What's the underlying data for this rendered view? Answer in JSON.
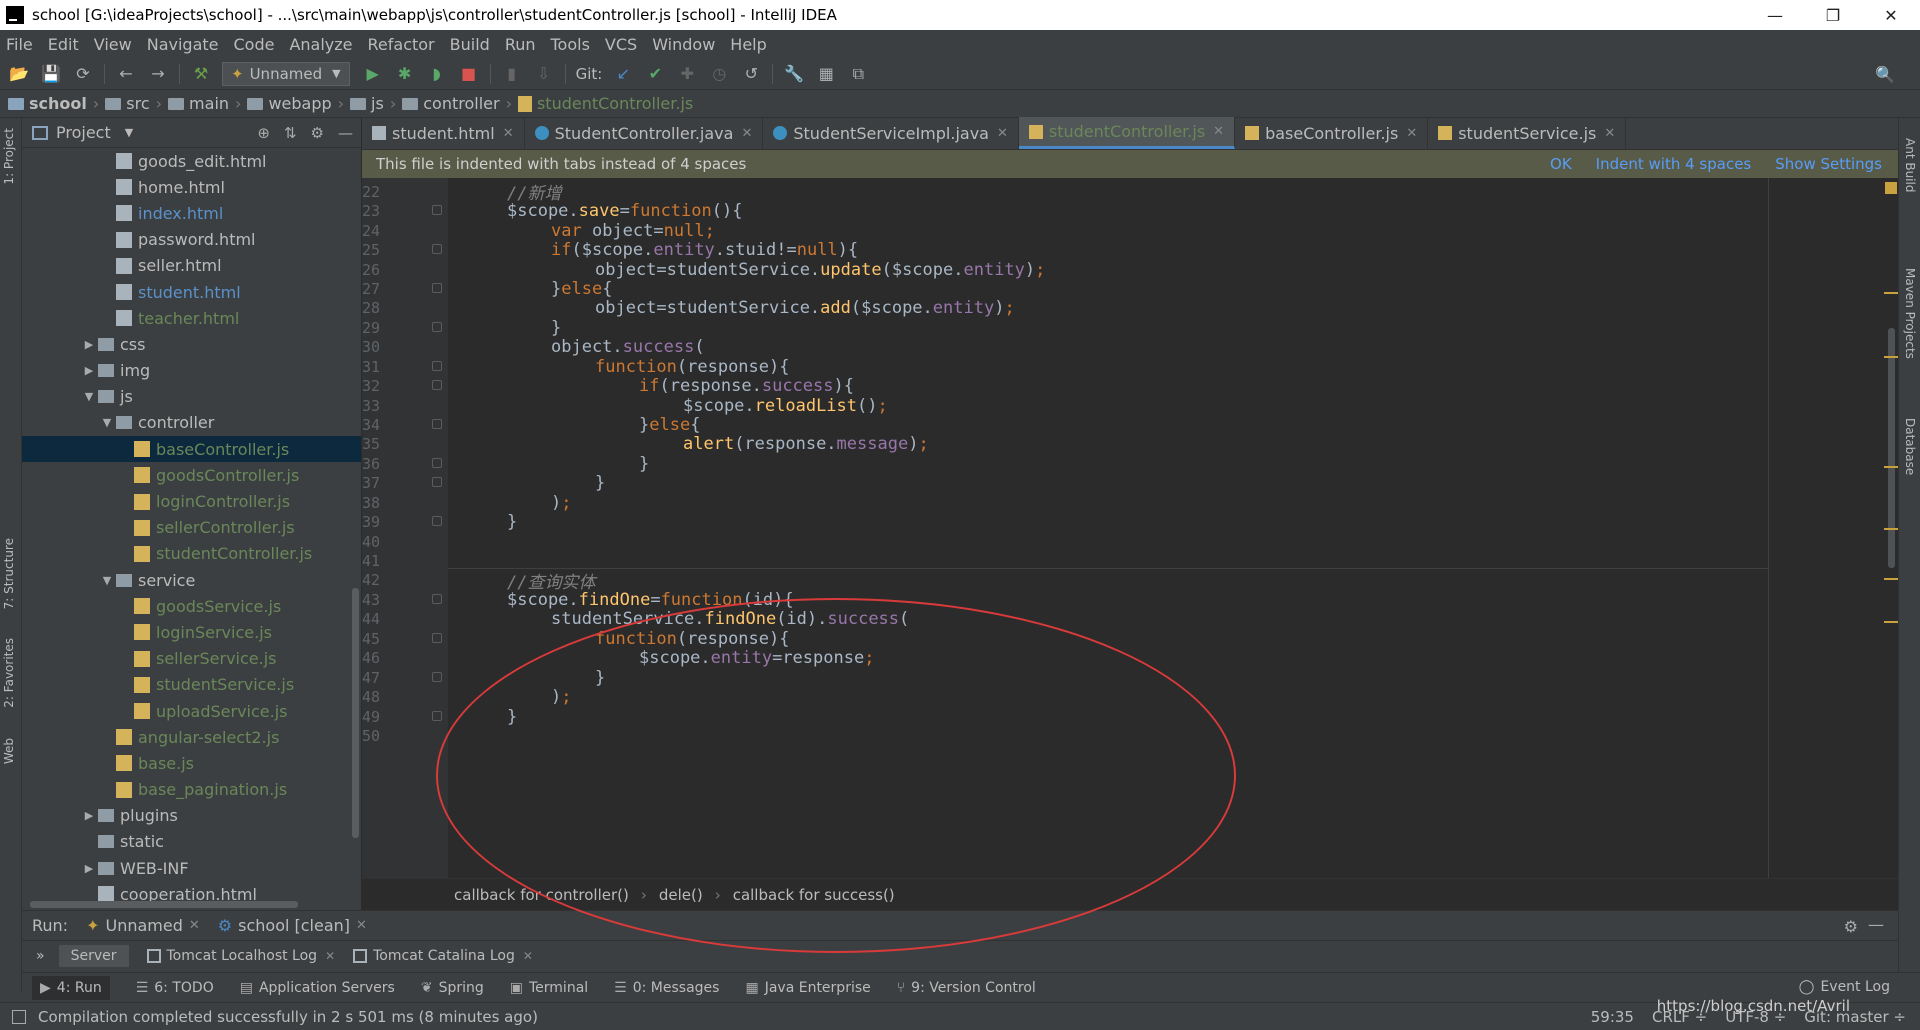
{
  "window": {
    "title": "school [G:\\ideaProjects\\school] - ...\\src\\main\\webapp\\js\\controller\\studentController.js [school] - IntelliJ IDEA",
    "minimize": "—",
    "restore": "❐",
    "close": "✕"
  },
  "menu": [
    "File",
    "Edit",
    "View",
    "Navigate",
    "Code",
    "Analyze",
    "Refactor",
    "Build",
    "Run",
    "Tools",
    "VCS",
    "Window",
    "Help"
  ],
  "toolbar": {
    "run_config": "Unnamed",
    "git_label": "Git:"
  },
  "breadcrumb": [
    "school",
    "src",
    "main",
    "webapp",
    "js",
    "controller",
    "studentController.js"
  ],
  "left_strip": {
    "project": "1: Project",
    "structure": "7: Structure",
    "favorites": "2: Favorites",
    "web": "Web"
  },
  "right_strip": {
    "ant": "Ant Build",
    "maven": "Maven Projects",
    "database": "Database"
  },
  "project_panel": {
    "title": "Project",
    "tree": [
      {
        "label": "goods_edit.html",
        "type": "html",
        "depth": 3,
        "color": "normal"
      },
      {
        "label": "home.html",
        "type": "html",
        "depth": 3,
        "color": "normal"
      },
      {
        "label": "index.html",
        "type": "html",
        "depth": 3,
        "color": "blue"
      },
      {
        "label": "password.html",
        "type": "html",
        "depth": 3,
        "color": "normal"
      },
      {
        "label": "seller.html",
        "type": "html",
        "depth": 3,
        "color": "normal"
      },
      {
        "label": "student.html",
        "type": "html",
        "depth": 3,
        "color": "blue"
      },
      {
        "label": "teacher.html",
        "type": "html",
        "depth": 3,
        "color": "green"
      },
      {
        "label": "css",
        "type": "folder",
        "depth": 2,
        "color": "normal",
        "arrow": "▶"
      },
      {
        "label": "img",
        "type": "folder",
        "depth": 2,
        "color": "normal",
        "arrow": "▶"
      },
      {
        "label": "js",
        "type": "folder",
        "depth": 2,
        "color": "normal",
        "arrow": "▼"
      },
      {
        "label": "controller",
        "type": "folder",
        "depth": 3,
        "color": "normal",
        "arrow": "▼"
      },
      {
        "label": "baseController.js",
        "type": "js",
        "depth": 4,
        "color": "green",
        "selected": true
      },
      {
        "label": "goodsController.js",
        "type": "js",
        "depth": 4,
        "color": "green"
      },
      {
        "label": "loginController.js",
        "type": "js",
        "depth": 4,
        "color": "green"
      },
      {
        "label": "sellerController.js",
        "type": "js",
        "depth": 4,
        "color": "green"
      },
      {
        "label": "studentController.js",
        "type": "js",
        "depth": 4,
        "color": "green"
      },
      {
        "label": "service",
        "type": "folder",
        "depth": 3,
        "color": "normal",
        "arrow": "▼"
      },
      {
        "label": "goodsService.js",
        "type": "js",
        "depth": 4,
        "color": "green"
      },
      {
        "label": "loginService.js",
        "type": "js",
        "depth": 4,
        "color": "green"
      },
      {
        "label": "sellerService.js",
        "type": "js",
        "depth": 4,
        "color": "green"
      },
      {
        "label": "studentService.js",
        "type": "js",
        "depth": 4,
        "color": "green"
      },
      {
        "label": "uploadService.js",
        "type": "js",
        "depth": 4,
        "color": "green"
      },
      {
        "label": "angular-select2.js",
        "type": "js",
        "depth": 3,
        "color": "green"
      },
      {
        "label": "base.js",
        "type": "js",
        "depth": 3,
        "color": "green"
      },
      {
        "label": "base_pagination.js",
        "type": "js",
        "depth": 3,
        "color": "green"
      },
      {
        "label": "plugins",
        "type": "folder",
        "depth": 2,
        "color": "normal",
        "arrow": "▶"
      },
      {
        "label": "static",
        "type": "folder",
        "depth": 2,
        "color": "normal"
      },
      {
        "label": "WEB-INF",
        "type": "folder",
        "depth": 2,
        "color": "normal",
        "arrow": "▶"
      },
      {
        "label": "cooperation.html",
        "type": "html",
        "depth": 2,
        "color": "normal"
      }
    ]
  },
  "editor": {
    "tabs": [
      {
        "label": "student.html",
        "icon": "html",
        "active": false
      },
      {
        "label": "StudentController.java",
        "icon": "java",
        "active": false
      },
      {
        "label": "StudentServiceImpl.java",
        "icon": "java",
        "active": false
      },
      {
        "label": "studentController.js",
        "icon": "js",
        "active": true
      },
      {
        "label": "baseController.js",
        "icon": "js",
        "active": false
      },
      {
        "label": "studentService.js",
        "icon": "js",
        "active": false
      }
    ],
    "banner": {
      "message": "This file is indented with tabs instead of 4 spaces",
      "ok": "OK",
      "indent": "Indent with 4 spaces",
      "settings": "Show Settings"
    },
    "lines": [
      {
        "n": "22",
        "indent": 4,
        "code": [
          [
            "cm",
            "//新增"
          ]
        ]
      },
      {
        "n": "23",
        "indent": 4,
        "fold": true,
        "code": [
          [
            "pl",
            "$scope."
          ],
          [
            "fn",
            "save"
          ],
          [
            "pl",
            "="
          ],
          [
            "kw",
            "function"
          ],
          [
            "pl",
            "(){"
          ]
        ]
      },
      {
        "n": "24",
        "indent": 5,
        "code": [
          [
            "kw",
            "var "
          ],
          [
            "pl",
            "object="
          ],
          [
            "kw",
            "null"
          ],
          [
            "kw",
            ";"
          ]
        ]
      },
      {
        "n": "25",
        "indent": 5,
        "fold": true,
        "code": [
          [
            "kw",
            "if"
          ],
          [
            "pl",
            "($scope."
          ],
          [
            "prop",
            "entity"
          ],
          [
            "pl",
            "."
          ],
          [
            "pl",
            "stuid"
          ],
          [
            "pl",
            "!="
          ],
          [
            "kw",
            "null"
          ],
          [
            "pl",
            "){"
          ]
        ]
      },
      {
        "n": "26",
        "indent": 6,
        "code": [
          [
            "pl",
            "object=studentService."
          ],
          [
            "fn",
            "update"
          ],
          [
            "pl",
            "($scope."
          ],
          [
            "prop",
            "entity"
          ],
          [
            "pl",
            ")"
          ],
          [
            "kw",
            ";"
          ]
        ]
      },
      {
        "n": "27",
        "indent": 5,
        "fold": true,
        "code": [
          [
            "pl",
            "}"
          ],
          [
            "kw",
            "else"
          ],
          [
            "pl",
            "{"
          ]
        ]
      },
      {
        "n": "28",
        "indent": 6,
        "code": [
          [
            "pl",
            "object=studentService."
          ],
          [
            "fn",
            "add"
          ],
          [
            "pl",
            "($scope."
          ],
          [
            "prop",
            "entity"
          ],
          [
            "pl",
            ")"
          ],
          [
            "kw",
            ";"
          ]
        ]
      },
      {
        "n": "29",
        "indent": 5,
        "fold": true,
        "code": [
          [
            "pl",
            "}"
          ]
        ]
      },
      {
        "n": "30",
        "indent": 5,
        "code": [
          [
            "pl",
            "object."
          ],
          [
            "prop",
            "success"
          ],
          [
            "pl",
            "("
          ]
        ]
      },
      {
        "n": "31",
        "indent": 6,
        "fold": true,
        "code": [
          [
            "kw",
            "function"
          ],
          [
            "pl",
            "(response){"
          ]
        ]
      },
      {
        "n": "32",
        "indent": 7,
        "fold": true,
        "code": [
          [
            "kw",
            "if"
          ],
          [
            "pl",
            "(response."
          ],
          [
            "prop",
            "success"
          ],
          [
            "pl",
            "){"
          ]
        ]
      },
      {
        "n": "33",
        "indent": 8,
        "code": [
          [
            "pl",
            "$scope."
          ],
          [
            "fn",
            "reloadList"
          ],
          [
            "pl",
            "()"
          ],
          [
            "kw",
            ";"
          ]
        ]
      },
      {
        "n": "34",
        "indent": 7,
        "fold": true,
        "code": [
          [
            "pl",
            "}"
          ],
          [
            "kw",
            "else"
          ],
          [
            "pl",
            "{"
          ]
        ]
      },
      {
        "n": "35",
        "indent": 8,
        "code": [
          [
            "fn",
            "alert"
          ],
          [
            "pl",
            "(response."
          ],
          [
            "prop",
            "message"
          ],
          [
            "pl",
            ")"
          ],
          [
            "kw",
            ";"
          ]
        ]
      },
      {
        "n": "36",
        "indent": 7,
        "fold": true,
        "code": [
          [
            "pl",
            "}"
          ]
        ]
      },
      {
        "n": "37",
        "indent": 6,
        "fold": true,
        "code": [
          [
            "pl",
            "}"
          ]
        ]
      },
      {
        "n": "38",
        "indent": 5,
        "code": [
          [
            "pl",
            ")"
          ],
          [
            "kw",
            ";"
          ]
        ]
      },
      {
        "n": "39",
        "indent": 4,
        "fold": true,
        "code": [
          [
            "pl",
            "}"
          ]
        ]
      },
      {
        "n": "40",
        "indent": 0,
        "code": []
      },
      {
        "n": "41",
        "indent": 0,
        "code": []
      },
      {
        "n": "42",
        "indent": 4,
        "code": [
          [
            "cm",
            "//查询实体"
          ]
        ]
      },
      {
        "n": "43",
        "indent": 4,
        "fold": true,
        "code": [
          [
            "pl",
            "$scope."
          ],
          [
            "fn",
            "findOne"
          ],
          [
            "pl",
            "="
          ],
          [
            "kw",
            "function"
          ],
          [
            "pl",
            "(id){"
          ]
        ]
      },
      {
        "n": "44",
        "indent": 5,
        "code": [
          [
            "pl",
            "studentService."
          ],
          [
            "fn",
            "findOne"
          ],
          [
            "pl",
            "(id)."
          ],
          [
            "prop",
            "success"
          ],
          [
            "pl",
            "("
          ]
        ]
      },
      {
        "n": "45",
        "indent": 6,
        "fold": true,
        "code": [
          [
            "kw",
            "function"
          ],
          [
            "pl",
            "(response){"
          ]
        ]
      },
      {
        "n": "46",
        "indent": 7,
        "code": [
          [
            "pl",
            "$scope."
          ],
          [
            "prop",
            "entity"
          ],
          [
            "pl",
            "=response"
          ],
          [
            "kw",
            ";"
          ]
        ]
      },
      {
        "n": "47",
        "indent": 6,
        "fold": true,
        "code": [
          [
            "pl",
            "}"
          ]
        ]
      },
      {
        "n": "48",
        "indent": 5,
        "code": [
          [
            "pl",
            ")"
          ],
          [
            "kw",
            ";"
          ]
        ]
      },
      {
        "n": "49",
        "indent": 4,
        "fold": true,
        "code": [
          [
            "pl",
            "}"
          ]
        ]
      },
      {
        "n": "50",
        "indent": 0,
        "code": []
      }
    ],
    "code_breadcrumb": [
      "callback for controller()",
      "dele()",
      "callback for success()"
    ]
  },
  "run_panel": {
    "label": "Run:",
    "tabs": [
      "Unnamed",
      "school [clean]"
    ],
    "subtabs": [
      "Server",
      "Tomcat Localhost Log",
      "Tomcat Catalina Log"
    ]
  },
  "bottom_tools": [
    "4: Run",
    "6: TODO",
    "Application Servers",
    "Spring",
    "Terminal",
    "0: Messages",
    "Java Enterprise",
    "9: Version Control"
  ],
  "event_log": "Event Log",
  "status": {
    "message": "Compilation completed successfully in 2 s 501 ms (8 minutes ago)",
    "position": "59:35",
    "line_sep": "CRLF ÷",
    "encoding": "UTF-8 ÷",
    "git": "Git: master ÷",
    "watermark": "https://blog.csdn.net/Avril"
  }
}
